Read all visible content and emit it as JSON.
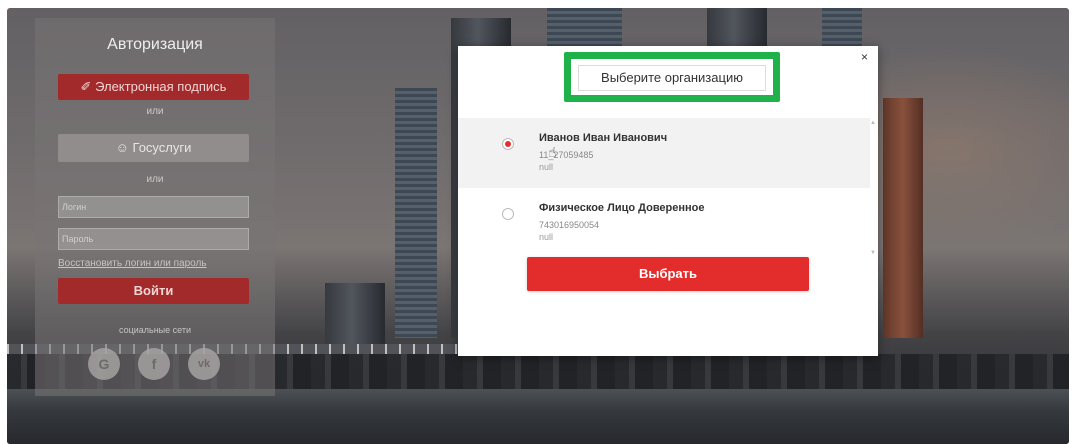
{
  "login": {
    "title": "Авторизация",
    "esign_label": "Электронная подпись",
    "or_1": "или",
    "gosuslugi_label": "Госуслуги",
    "or_2": "или",
    "login_placeholder": "Логин",
    "password_placeholder": "Пароль",
    "restore_link": "Восстановить логин или пароль",
    "submit_label": "Войти",
    "social_label": "социальные сети",
    "social": [
      "G",
      "f",
      "vk"
    ]
  },
  "modal": {
    "title": "Выберите организацию",
    "close": "×",
    "organizations": [
      {
        "name": "Иванов Иван Иванович",
        "inn": "11_27059485",
        "extra": "null",
        "selected": true
      },
      {
        "name": "Физическое Лицо Доверенное",
        "inn": "743016950054",
        "extra": "null",
        "selected": false
      }
    ],
    "choose_label": "Выбрать"
  },
  "colors": {
    "accent": "#e32c2c",
    "highlight": "#1fb14a"
  }
}
